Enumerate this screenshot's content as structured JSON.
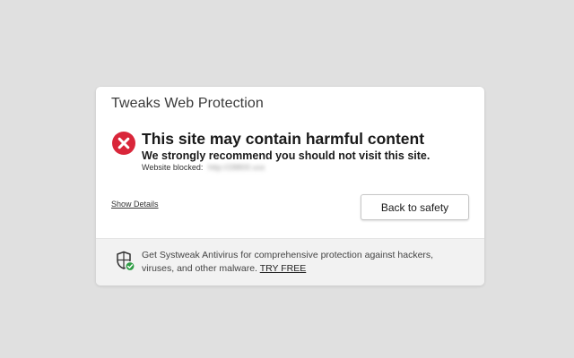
{
  "dialog": {
    "title": "Tweaks Web Protection",
    "headline": "This site may contain harmful content",
    "subline": "We strongly recommend you should not visit this site.",
    "blocked_label": "Website blocked:",
    "blocked_url": "http://28800.xxx",
    "show_details": "Show Details",
    "back_button": "Back to safety"
  },
  "footer": {
    "promo_text": "Get Systweak Antivirus for comprehensive protection against hackers, viruses, and other malware.",
    "try_free": "TRY FREE"
  },
  "icons": {
    "danger": "danger-x-icon",
    "shield": "shield-check-icon"
  },
  "colors": {
    "danger_red": "#d9263a",
    "check_green": "#2e9d44",
    "background": "#e0e0e0",
    "footer_bg": "#f2f2f2"
  }
}
